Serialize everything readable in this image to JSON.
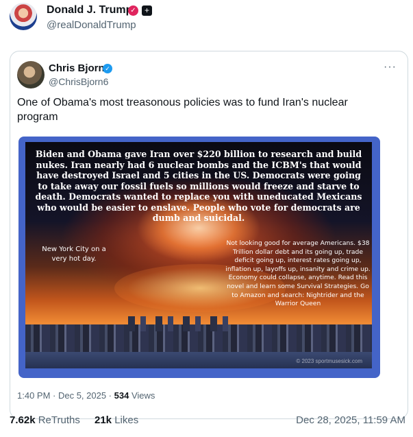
{
  "header": {
    "display_name": "Donald J. Trump",
    "handle": "@realDonaldTrump",
    "badge_icon": "verified-badge-icon",
    "extra_icon": "plus-icon"
  },
  "quoted": {
    "display_name": "Chris Bjorn",
    "handle": "@ChrisBjorn6",
    "more_label": "···",
    "text": "One of Obama's most treasonous policies was to fund Iran's nuclear program",
    "image": {
      "main_caption": "Biden and Obama gave Iran over $220 billion to research and build nukes. Iran nearly had 6 nuclear bombs and the ICBM's that would have destroyed Israel and 5 cities in the US. Democrats were going to take away our fossil fuels so millions would freeze and starve to death. Democrats wanted to replace you with uneducated Mexicans who would be easier to enslave. People who vote for democrats are dumb and suicidal.",
      "left_caption": "New York City on a very hot day.",
      "right_caption": "Not looking good for average Americans. $38 Trillion dollar debt and its going up, trade deficit going up, interest rates going up, inflation up, layoffs up, insanity and crime up. Economy could collapse, anytime. Read this novel and learn some Survival Strategies. Go to Amazon and search: Nightrider and the Warrior Queen",
      "watermark": "© 2023 sportmusesick.com"
    },
    "time": "1:40 PM · Dec 5, 2025 ·",
    "views_count": "534",
    "views_label": "Views"
  },
  "stats": {
    "retruths_count": "7.62k",
    "retruths_label": "ReTruths",
    "likes_count": "21k",
    "likes_label": "Likes",
    "date": "Dec 28, 2025, 11:59 AM"
  }
}
